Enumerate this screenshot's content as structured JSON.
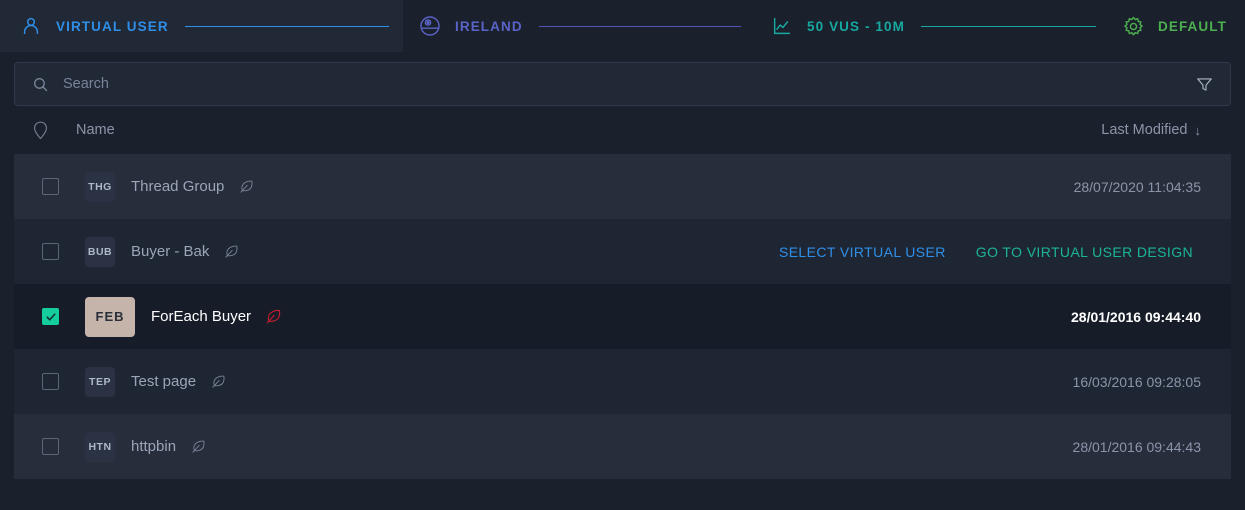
{
  "breadcrumb": {
    "items": [
      {
        "icon": "user-icon",
        "label": "VIRTUAL USER",
        "color": "#2f8fe8"
      },
      {
        "icon": "globe-icon",
        "label": "IRELAND",
        "color": "#5a63c8"
      },
      {
        "icon": "line-chart-icon",
        "label": "50 VUS - 10M",
        "color": "#17a8a0"
      },
      {
        "icon": "gear-icon",
        "label": "DEFAULT",
        "color": "#4caf50"
      }
    ]
  },
  "search": {
    "placeholder": "Search",
    "value": "",
    "icon": "search-icon",
    "filter_icon": "filter-funnel-icon"
  },
  "table": {
    "headers": {
      "pin_icon": "pin-outline-icon",
      "name": "Name",
      "last_modified": "Last Modified",
      "sort_arrow": "↓"
    },
    "rows": [
      {
        "checked": false,
        "badge": "THG",
        "name": "Thread Group",
        "leaf_icon": "feather-icon",
        "date": "28/07/2020 11:04:35",
        "hovered": false
      },
      {
        "checked": false,
        "badge": "BUB",
        "name": "Buyer - Bak",
        "leaf_icon": "feather-icon",
        "date": "",
        "hovered": true,
        "actions": [
          {
            "label": "SELECT VIRTUAL USER",
            "color": "#2f8fe8"
          },
          {
            "label": "GO TO VIRTUAL USER DESIGN",
            "color": "#1bb596"
          }
        ]
      },
      {
        "checked": true,
        "badge": "FEB",
        "name": "ForEach Buyer",
        "leaf_icon": "feather-icon-red",
        "date": "28/01/2016 09:44:40",
        "selected": true
      },
      {
        "checked": false,
        "badge": "TEP",
        "name": "Test page",
        "leaf_icon": "feather-icon",
        "date": "16/03/2016 09:28:05",
        "hovered": false
      },
      {
        "checked": false,
        "badge": "HTN",
        "name": "httpbin",
        "leaf_icon": "feather-icon",
        "date": "28/01/2016 09:44:43",
        "hovered": false
      }
    ]
  },
  "colors": {
    "accent_blue": "#2f8fe8",
    "accent_teal": "#17a8a0",
    "accent_green": "#4caf50",
    "accent_indigo": "#5a63c8",
    "checkbox_checked": "#14cf9b",
    "badge_highlight": "#c4b4aa",
    "scrollbar": "#2196e3",
    "background": "#1b212c"
  }
}
